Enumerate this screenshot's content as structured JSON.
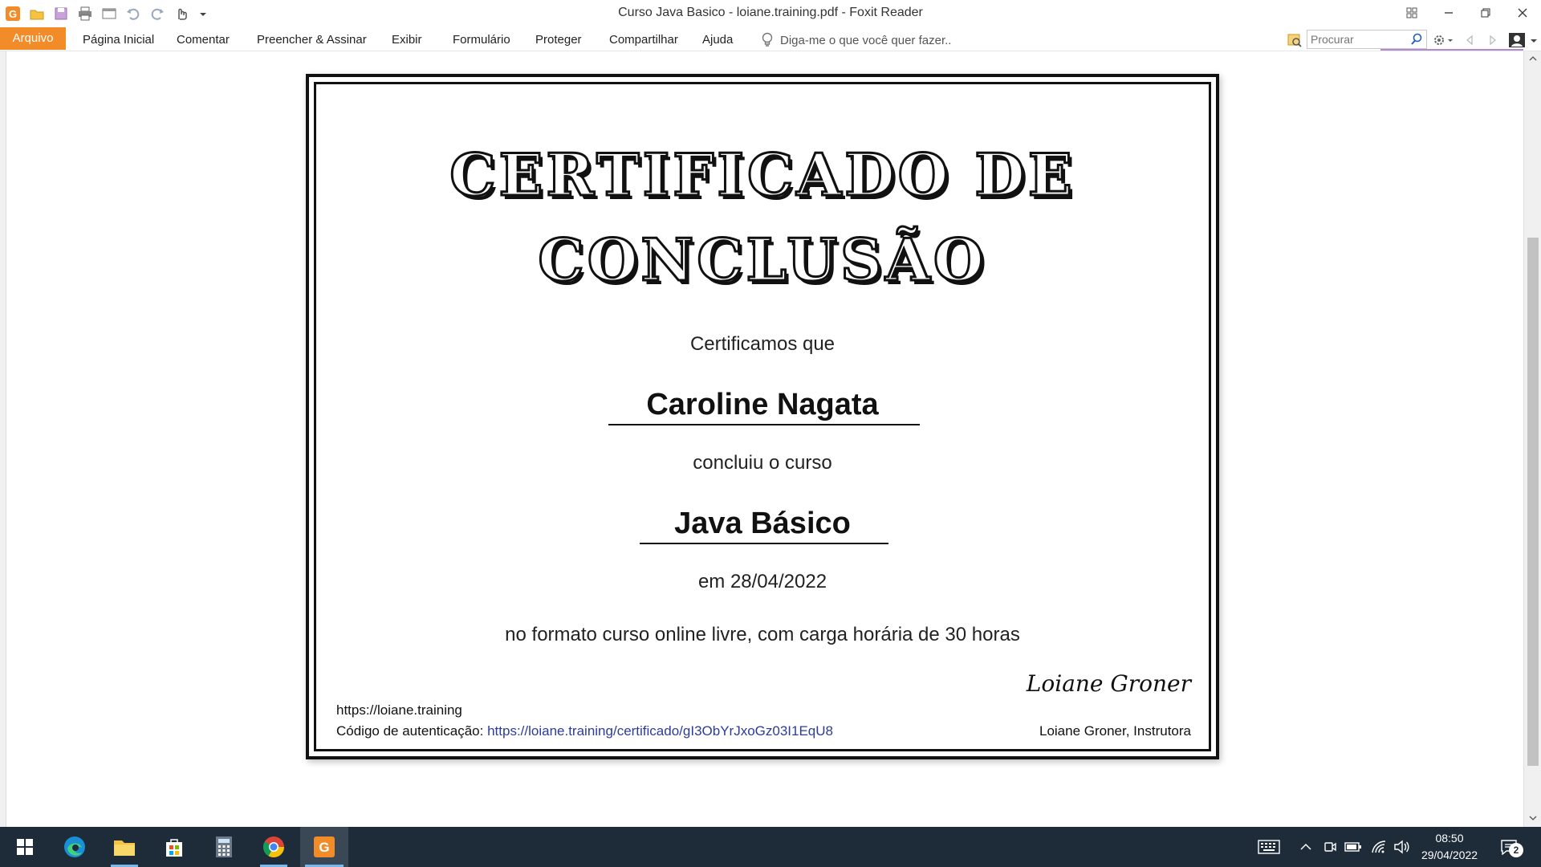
{
  "window": {
    "title": "Curso Java Basico - loiane.training.pdf - Foxit Reader"
  },
  "quick_access": {
    "icons": [
      "foxit-logo-icon",
      "open-folder-icon",
      "save-icon",
      "print-icon",
      "window-icon",
      "undo-icon",
      "redo-icon",
      "hand-tool-icon",
      "dropdown-icon"
    ]
  },
  "menu": {
    "file": "Arquivo",
    "items": [
      "Página Inicial",
      "Comentar",
      "Preencher & Assinar",
      "Exibir",
      "Formulário",
      "Proteger",
      "Compartilhar",
      "Ajuda"
    ],
    "tell_me": "Diga-me o que você quer fazer..",
    "search_placeholder": "Procurar"
  },
  "certificate": {
    "title_line1": "CERTIFICADO DE",
    "title_line2": "CONCLUSÃO",
    "certify_text": "Certificamos que",
    "student_name": "Caroline Nagata",
    "completed_text": "concluiu o curso",
    "course_name": "Java Básico",
    "date_text": "em 28/04/2022",
    "format_text": "no formato curso online livre, com carga horária de 30 horas",
    "website": "https://loiane.training",
    "auth_label": "Código de autenticação:",
    "auth_link": "https://loiane.training/certificado/gI3ObYrJxoGz03I1EqU8",
    "signature": "Loiane Groner",
    "signer": "Loiane Groner, Instrutora"
  },
  "taskbar": {
    "apps": [
      "start-icon",
      "edge-icon",
      "file-explorer-icon",
      "store-icon",
      "calculator-icon",
      "chrome-icon",
      "foxit-reader-icon"
    ],
    "time": "08:50",
    "date": "29/04/2022",
    "notifications": "2"
  },
  "colors": {
    "accent": "#f28c28",
    "taskbar": "#1e2c3a",
    "link": "#2b3c9c"
  }
}
